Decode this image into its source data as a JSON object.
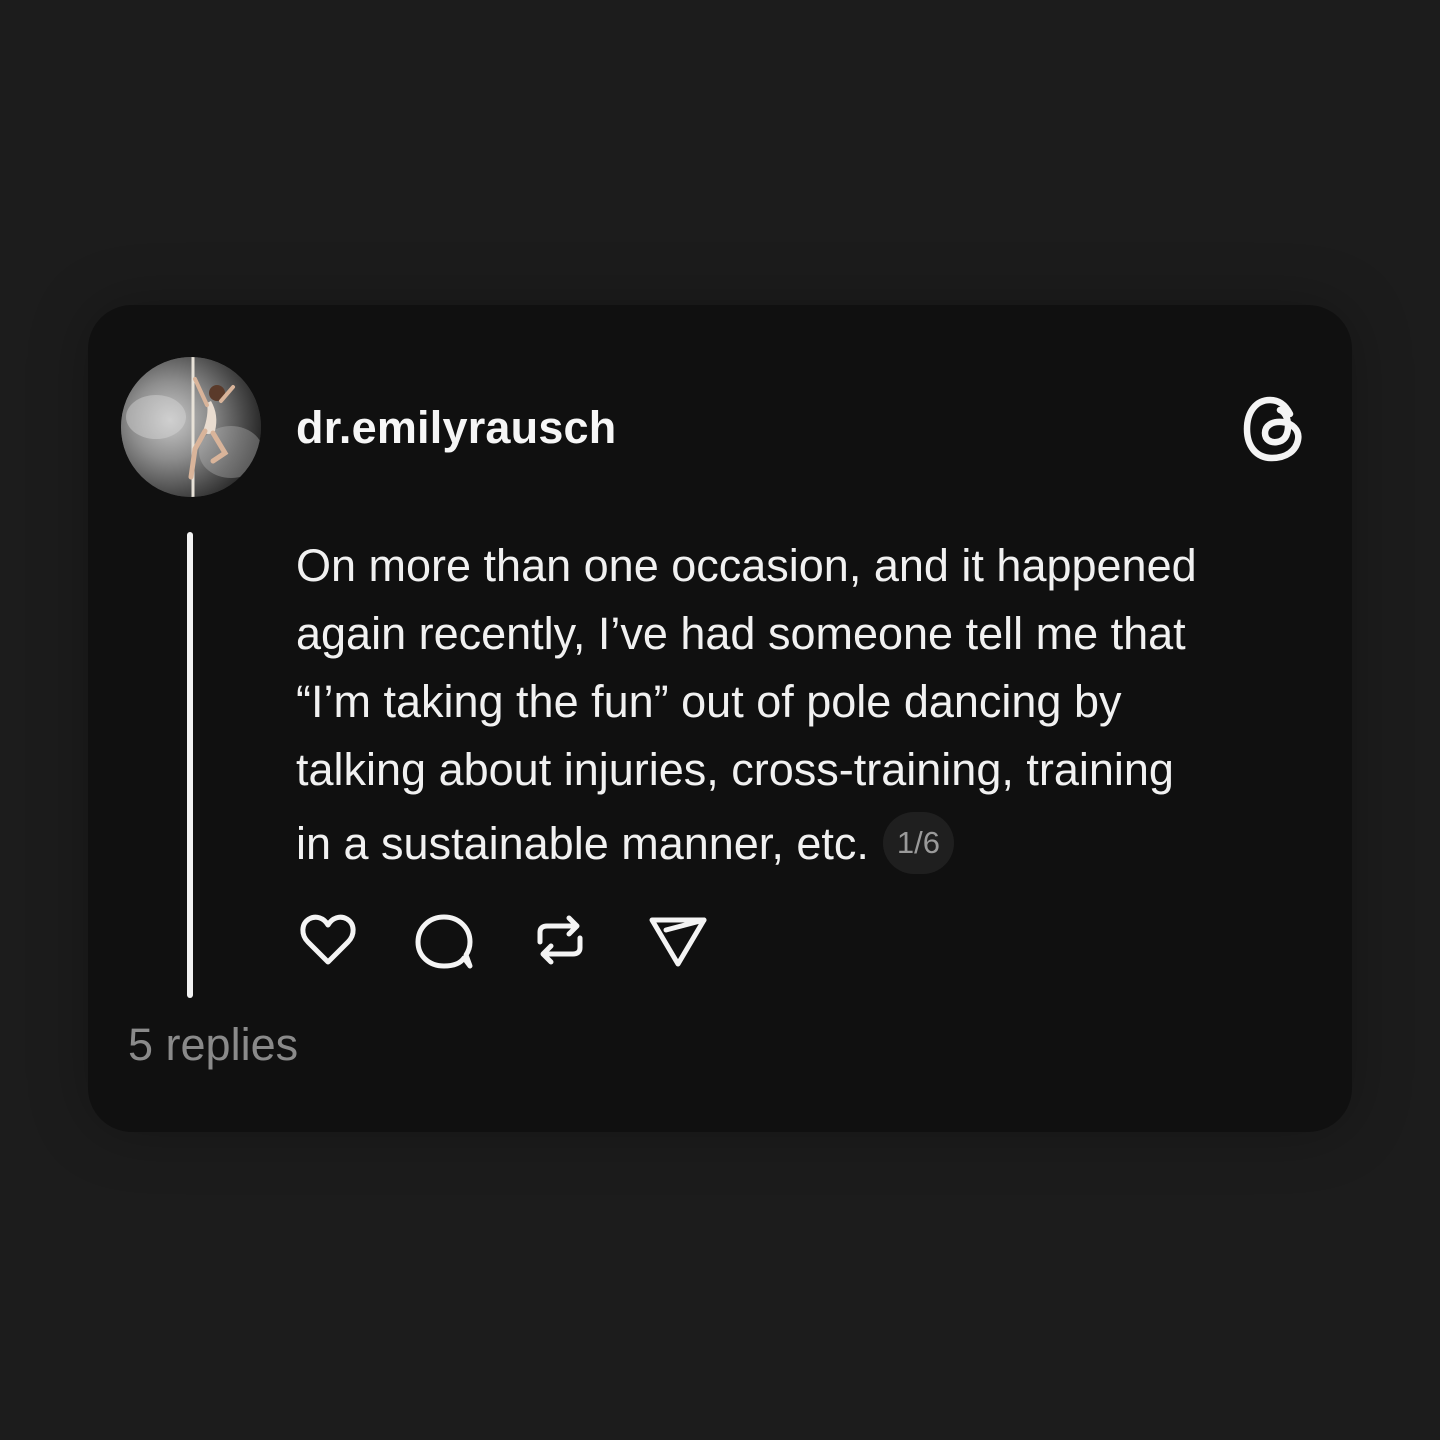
{
  "post": {
    "username": "dr.emilyrausch",
    "text_lines": [
      "On more than one occasion, and it happened",
      "again recently, I’ve had someone tell me that",
      "“I’m taking the fun” out of pole dancing by",
      "talking about injuries, cross-training, training",
      "in a sustainable manner, etc."
    ],
    "page_indicator": "1/6",
    "replies": "5 replies"
  },
  "icons": {
    "brand": "threads-logo-icon",
    "like": "heart-icon",
    "comment": "comment-bubble-icon",
    "repost": "repost-icon",
    "share": "send-icon"
  },
  "colors": {
    "page_background": "#1c1c1c",
    "card_background": "#101010",
    "text_primary": "#f3f3f3",
    "text_muted": "#8a8a8a",
    "badge_background": "#1f1f1f"
  }
}
